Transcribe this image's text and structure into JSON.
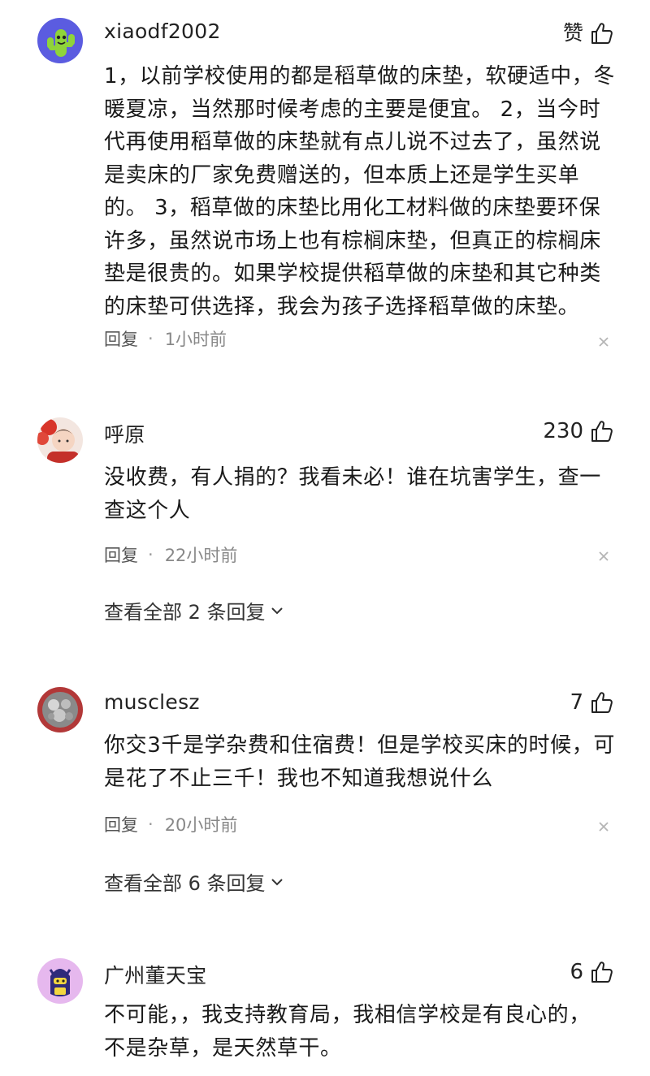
{
  "comments": [
    {
      "username": "xiaodf2002",
      "like_label": "赞",
      "lines": [
        "1，以前学校使用的都是稻草做的床垫，软硬适中，冬",
        "暖夏凉，当然那时候考虑的主要是便宜。 2，当今时",
        "代再使用稻草做的床垫就有点儿说不过去了，虽然说",
        "是卖床的厂家免费赠送的，但本质上还是学生买单",
        "的。 3，稻草做的床垫比用化工材料做的床垫要环保",
        "许多，虽然说市场上也有棕榈床垫，但真正的棕榈床",
        "垫是很贵的。如果学校提供稻草做的床垫和其它种类",
        "的床垫可供选择，我会为孩子选择稻草做的床垫。"
      ],
      "reply_label": "回复",
      "dot": "·",
      "time": "1小时前"
    },
    {
      "username": "呼原",
      "like_count": "230",
      "lines": [
        "没收费，有人捐的？我看未必！谁在坑害学生，查一",
        "查这个人"
      ],
      "reply_label": "回复",
      "dot": "·",
      "time": "22小时前",
      "view_all": "查看全部 2 条回复"
    },
    {
      "username": "musclesz",
      "like_count": "7",
      "lines": [
        "你交3千是学杂费和住宿费！但是学校买床的时候，可",
        "是花了不止三千！我也不知道我想说什么"
      ],
      "reply_label": "回复",
      "dot": "·",
      "time": "20小时前",
      "view_all": "查看全部 6 条回复"
    },
    {
      "username": "广州董天宝",
      "like_count": "6",
      "lines": [
        "不可能，，我支持教育局，我相信学校是有良心的，",
        "不是杂草，是天然草干。"
      ]
    }
  ]
}
